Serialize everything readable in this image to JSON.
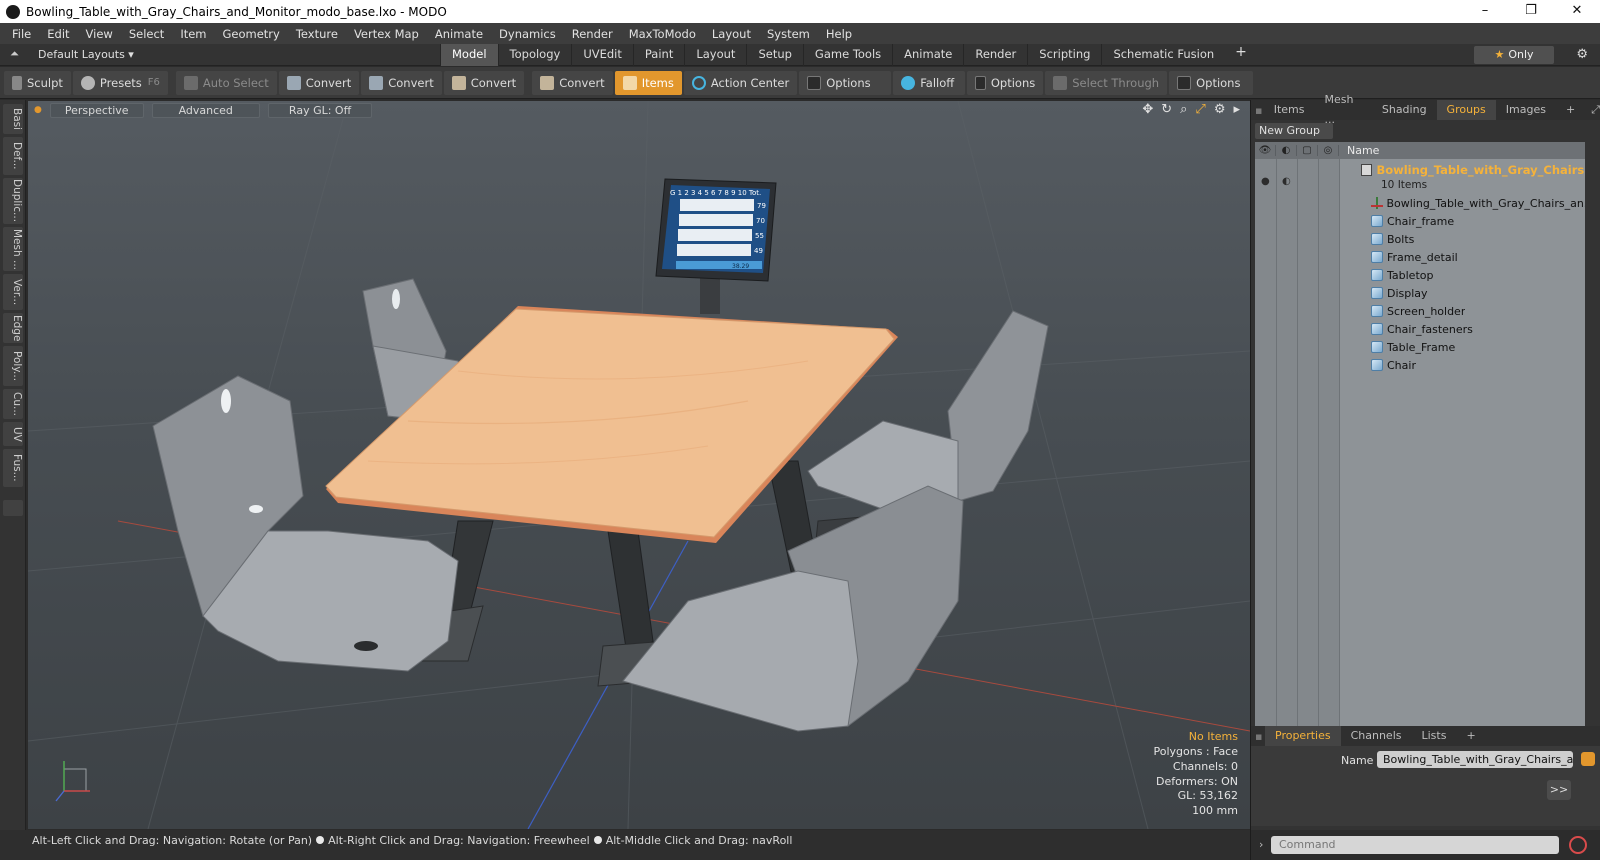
{
  "window": {
    "title": "Bowling_Table_with_Gray_Chairs_and_Monitor_modo_base.lxo - MODO",
    "controls": {
      "minimize": "–",
      "maximize": "❐",
      "close": "✕"
    }
  },
  "menu": [
    "File",
    "Edit",
    "View",
    "Select",
    "Item",
    "Geometry",
    "Texture",
    "Vertex Map",
    "Animate",
    "Dynamics",
    "Render",
    "MaxToModo",
    "Layout",
    "System",
    "Help"
  ],
  "layouts": {
    "label": "Default Layouts ▾",
    "tabs": [
      "Model",
      "Topology",
      "UVEdit",
      "Paint",
      "Layout",
      "Setup",
      "Game Tools",
      "Animate",
      "Render",
      "Scripting",
      "Schematic Fusion"
    ],
    "active_tab": "Model",
    "add_label": "+",
    "only_label": "Only"
  },
  "toolbar": {
    "sculpt": "Sculpt",
    "presets": "Presets",
    "presets_key": "F6",
    "auto_select": "Auto Select",
    "convert1": "Convert",
    "convert2": "Convert",
    "convert3": "Convert",
    "convert4": "Convert",
    "items": "Items",
    "action_center": "Action Center",
    "options1": "Options",
    "falloff": "Falloff",
    "options2": "Options",
    "select_through": "Select Through",
    "options3": "Options"
  },
  "left_tabs": [
    "Basi",
    "Def...",
    "Duplic...",
    "Mesh ...",
    "Ver...",
    "Edge",
    "Poly...",
    "Cu...",
    "UV",
    "Fus..."
  ],
  "viewport": {
    "view_mode": "Perspective",
    "shading": "Advanced",
    "raygl": "Ray GL: Off",
    "monitor": {
      "header": "G  1 2 3 4 5 6 7 8 9 10 Tot.",
      "scores": [
        "79",
        "70",
        "55",
        "49"
      ],
      "total": "38.29"
    },
    "info": {
      "items": "No Items",
      "polygons": "Polygons : Face",
      "channels": "Channels: 0",
      "deformers": "Deformers: ON",
      "gl": "GL: 53,162",
      "scale": "100 mm"
    }
  },
  "status": {
    "hint1": "Alt-Left Click and Drag: Navigation: Rotate (or Pan)",
    "hint2": "Alt-Right Click and Drag: Navigation: Freewheel",
    "hint3": "Alt-Middle Click and Drag: navRoll"
  },
  "right_panel": {
    "tabs": [
      "Items",
      "Mesh ...",
      "Shading",
      "Groups",
      "Images"
    ],
    "active_tab": "Groups",
    "add_tab": "+",
    "new_group": "New Group",
    "column_name": "Name",
    "group": {
      "name": "Bowling_Table_with_Gray_Chairs...",
      "count": "10 Items"
    },
    "items": [
      "Bowling_Table_with_Gray_Chairs_an...",
      "Chair_frame",
      "Bolts",
      "Frame_detail",
      "Tabletop",
      "Display",
      "Screen_holder",
      "Chair_fasteners",
      "Table_Frame",
      "Chair"
    ],
    "props_tabs": [
      "Properties",
      "Channels",
      "Lists"
    ],
    "props_active": "Properties",
    "props_add": "+",
    "name_label": "Name",
    "name_value": "Bowling_Table_with_Gray_Chairs_and_",
    "expand_label": ">>",
    "command_placeholder": "Command"
  },
  "colors": {
    "accent": "#e2972d",
    "highlight_text": "#f5b23a",
    "viewport_bg": "#4a5055"
  }
}
